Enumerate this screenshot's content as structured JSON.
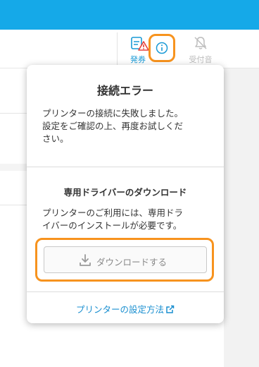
{
  "toolbar": {
    "issue_label": "発券",
    "receive_label": "受付音"
  },
  "popover": {
    "title": "接続エラー",
    "message_lines": [
      "プリンターの接続に失敗しました。",
      "設定をご確認の上、再度お試しくだ",
      "さい。"
    ],
    "driver_title": "専用ドライバーのダウンロード",
    "driver_lines": [
      "プリンターのご利用には、専用ドラ",
      "イバーのインストールが必要です。"
    ],
    "download_button": "ダウンロードする",
    "setup_link": "プリンターの設定方法"
  },
  "colors": {
    "header_blue": "#15a9e8",
    "highlight_orange": "#f7931e",
    "link_blue": "#1a8fd0",
    "error_red": "#e8413a"
  },
  "icons": {
    "issue": "ticket-issue-icon",
    "error_badge": "warning-triangle-icon",
    "info": "info-icon",
    "receive": "bell-off-icon",
    "download": "download-icon",
    "external": "external-link-icon"
  }
}
